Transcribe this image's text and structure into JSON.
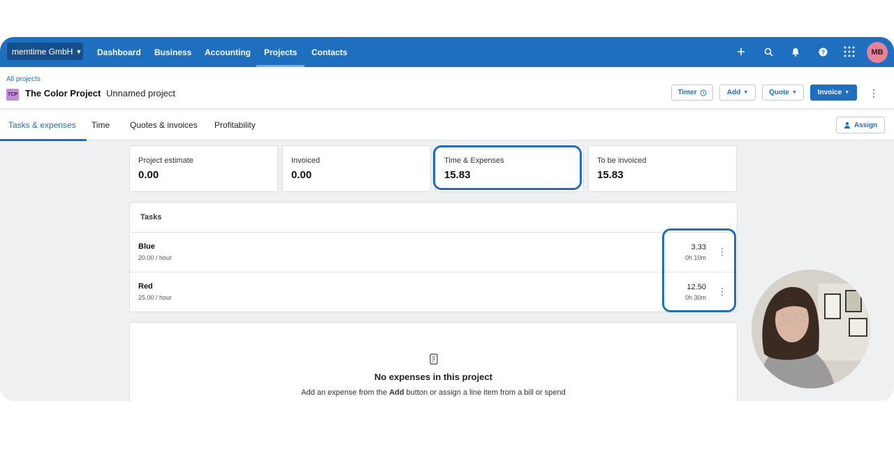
{
  "topbar": {
    "org": "memtime GmbH",
    "nav": [
      "Dashboard",
      "Business",
      "Accounting",
      "Projects",
      "Contacts"
    ],
    "active_nav": "Projects",
    "avatar": "MB"
  },
  "header": {
    "breadcrumb": "All projects",
    "badge": "TCP",
    "title": "The Color Project",
    "subtitle": "Unnamed project",
    "buttons": {
      "timer": "Timer",
      "add": "Add",
      "quote": "Quote",
      "invoice": "Invoice"
    }
  },
  "tabs": [
    "Tasks & expenses",
    "Time",
    "Quotes & invoices",
    "Profitability"
  ],
  "assign_label": "Assign",
  "summary": [
    {
      "label": "Project estimate",
      "value": "0.00"
    },
    {
      "label": "Invoiced",
      "value": "0.00"
    },
    {
      "label": "Time & Expenses",
      "value": "15.83"
    },
    {
      "label": "To be invoiced",
      "value": "15.83"
    }
  ],
  "tasks": {
    "heading": "Tasks",
    "rows": [
      {
        "name": "Blue",
        "rate": "20.00 / hour",
        "amount": "3.33",
        "duration": "0h 10m"
      },
      {
        "name": "Red",
        "rate": "25.00 / hour",
        "amount": "12.50",
        "duration": "0h 30m"
      }
    ]
  },
  "expenses": {
    "title": "No expenses in this project",
    "desc_prefix": "Add an expense from the ",
    "desc_bold": "Add",
    "desc_suffix": " button or assign a line item from a bill or spend"
  },
  "colors": {
    "primary": "#1f6fc0",
    "nav_bg": "#1f6fc0",
    "avatar_bg": "#e8819c",
    "highlight": "#1f6fc0"
  }
}
